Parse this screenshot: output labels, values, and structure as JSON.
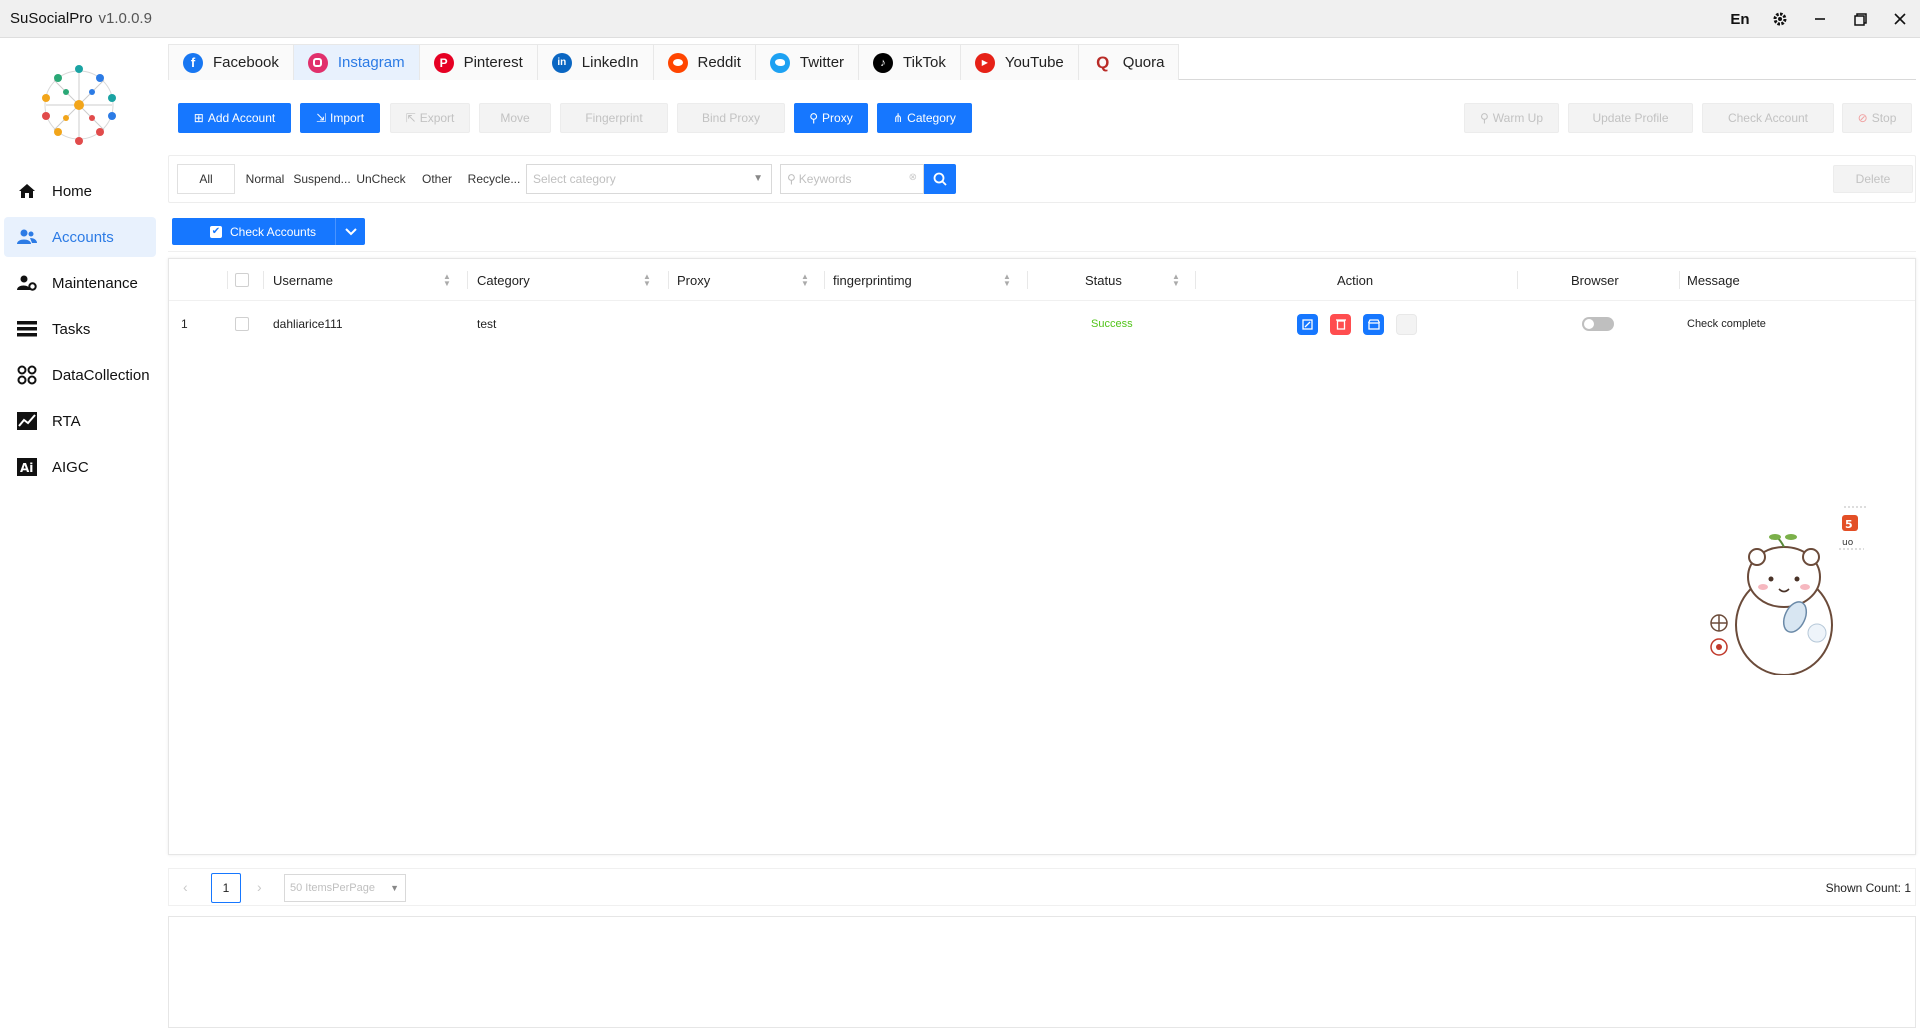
{
  "titlebar": {
    "app_name": "SuSocialPro",
    "version": "v1.0.0.9",
    "lang": "En"
  },
  "sidebar": {
    "items": [
      {
        "label": "Home",
        "icon": "home-icon"
      },
      {
        "label": "Accounts",
        "icon": "users-icon",
        "active": true
      },
      {
        "label": "Maintenance",
        "icon": "user-gear-icon"
      },
      {
        "label": "Tasks",
        "icon": "tasks-icon"
      },
      {
        "label": "DataCollection",
        "icon": "data-collection-icon"
      },
      {
        "label": "RTA",
        "icon": "chart-line-icon"
      },
      {
        "label": "AIGC",
        "icon": "ai-icon"
      }
    ]
  },
  "tabs": [
    {
      "label": "Facebook",
      "color": "#1877f2"
    },
    {
      "label": "Instagram",
      "color": "#e1306c",
      "active": true
    },
    {
      "label": "Pinterest",
      "color": "#e60023"
    },
    {
      "label": "LinkedIn",
      "color": "#0a66c2"
    },
    {
      "label": "Reddit",
      "color": "#ff4500"
    },
    {
      "label": "Twitter",
      "color": "#1da1f2"
    },
    {
      "label": "TikTok",
      "color": "#000000"
    },
    {
      "label": "YouTube",
      "color": "#e62117"
    },
    {
      "label": "Quora",
      "color": "#b92b27"
    }
  ],
  "toolbar": {
    "add_account": "Add Account",
    "import": "Import",
    "export": "Export",
    "move": "Move",
    "fingerprint": "Fingerprint",
    "bind_proxy": "Bind Proxy",
    "proxy": "Proxy",
    "category": "Category",
    "warm_up": "Warm Up",
    "update_profile": "Update Profile",
    "check_account": "Check Account",
    "stop": "Stop"
  },
  "filter": {
    "tabs": [
      "All",
      "Normal",
      "Suspend...",
      "UnCheck",
      "Other",
      "Recycle..."
    ],
    "category_placeholder": "Select category",
    "keywords_placeholder": "Keywords",
    "delete": "Delete"
  },
  "check_accounts": {
    "label": "Check Accounts"
  },
  "table": {
    "headers": [
      "Username",
      "Category",
      "Proxy",
      "fingerprintimg",
      "Status",
      "Action",
      "Browser",
      "Message"
    ],
    "rows": [
      {
        "index": "1",
        "username": "dahliarice111",
        "category": "test",
        "proxy": "",
        "fingerprint": "",
        "status": "Success",
        "message": "Check complete"
      }
    ]
  },
  "pager": {
    "page": "1",
    "page_size": "50 ItemsPerPage",
    "shown_count": "Shown Count:  1"
  },
  "colors": {
    "primary": "#1677ff",
    "success": "#52c41a",
    "danger": "#ff4d4f"
  }
}
